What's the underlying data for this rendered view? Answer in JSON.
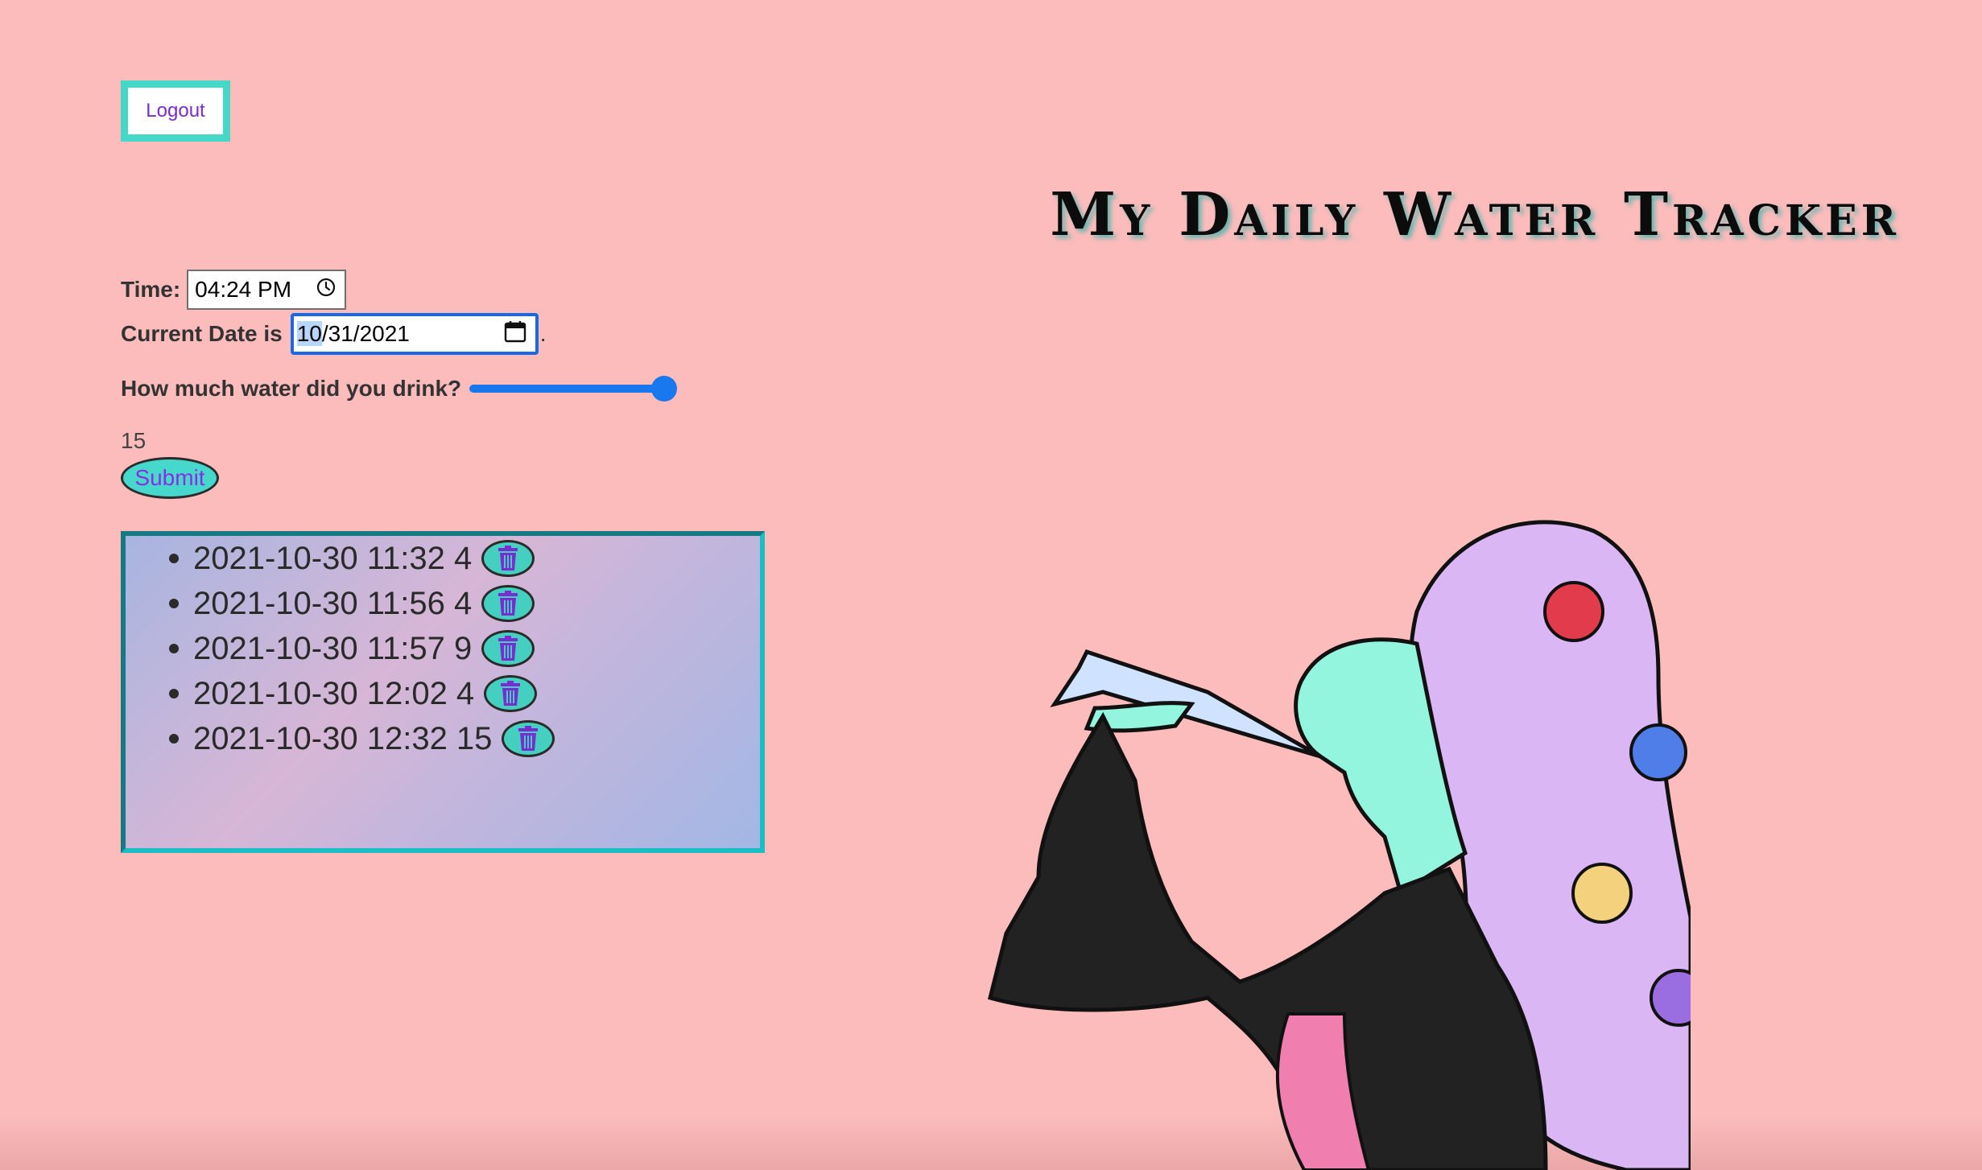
{
  "header": {
    "logout_label": "Logout",
    "title": "My Daily Water Tracker"
  },
  "form": {
    "time_label": "Time:",
    "time_value": "04:24 PM",
    "date_label": "Current Date is",
    "date_value_highlight": "10",
    "date_value_rest": "/31/2021",
    "date_suffix": ".",
    "amount_label": "How much water did you drink?",
    "amount_value": "15",
    "slider_fraction": 1.0,
    "submit_label": "Submit"
  },
  "entries": [
    {
      "text": "2021-10-30 11:32 4"
    },
    {
      "text": "2021-10-30 11:56 4"
    },
    {
      "text": "2021-10-30 11:57 9"
    },
    {
      "text": "2021-10-30 12:02 4"
    },
    {
      "text": "2021-10-30 12:32 15"
    }
  ],
  "colors": {
    "background": "#fdbcbc",
    "accent_teal": "#45d8c8",
    "accent_purple": "#7a2bd1",
    "slider_blue": "#1a78ef"
  },
  "icons": {
    "delete": "trash-icon",
    "time": "clock-icon",
    "date": "calendar-icon"
  }
}
